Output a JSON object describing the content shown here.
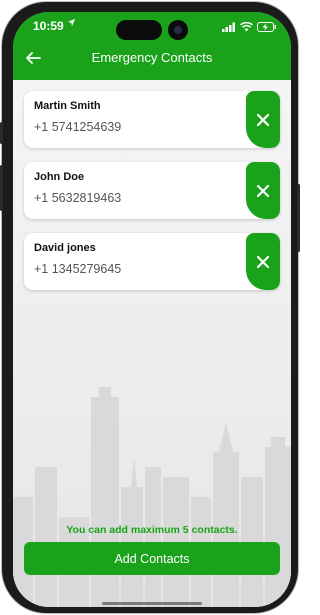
{
  "status_bar": {
    "time": "10:59"
  },
  "header": {
    "title": "Emergency Contacts"
  },
  "contacts": [
    {
      "name": "Martin Smith",
      "phone": "+1 5741254639"
    },
    {
      "name": "John Doe",
      "phone": "+1 5632819463"
    },
    {
      "name": "David jones",
      "phone": "+1 1345279645"
    }
  ],
  "footer": {
    "hint": "You can add maximum 5 contacts.",
    "add_button_label": "Add Contacts"
  },
  "colors": {
    "accent": "#1aa31a",
    "background": "#ededed"
  }
}
